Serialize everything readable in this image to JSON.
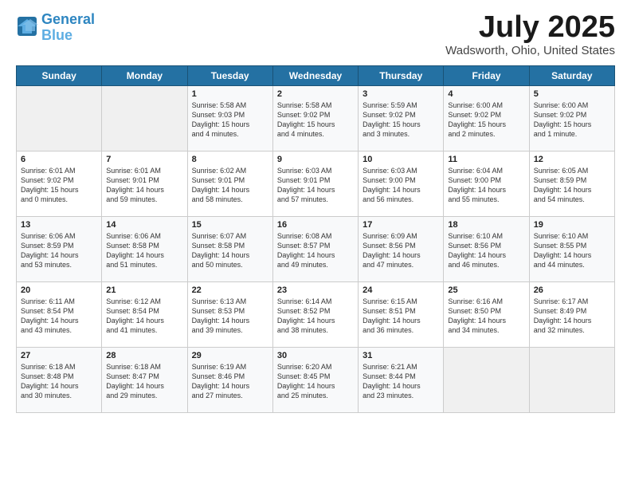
{
  "header": {
    "logo_line1": "General",
    "logo_line2": "Blue",
    "month": "July 2025",
    "location": "Wadsworth, Ohio, United States"
  },
  "weekdays": [
    "Sunday",
    "Monday",
    "Tuesday",
    "Wednesday",
    "Thursday",
    "Friday",
    "Saturday"
  ],
  "weeks": [
    [
      {
        "day": "",
        "info": ""
      },
      {
        "day": "",
        "info": ""
      },
      {
        "day": "1",
        "info": "Sunrise: 5:58 AM\nSunset: 9:03 PM\nDaylight: 15 hours\nand 4 minutes."
      },
      {
        "day": "2",
        "info": "Sunrise: 5:58 AM\nSunset: 9:02 PM\nDaylight: 15 hours\nand 4 minutes."
      },
      {
        "day": "3",
        "info": "Sunrise: 5:59 AM\nSunset: 9:02 PM\nDaylight: 15 hours\nand 3 minutes."
      },
      {
        "day": "4",
        "info": "Sunrise: 6:00 AM\nSunset: 9:02 PM\nDaylight: 15 hours\nand 2 minutes."
      },
      {
        "day": "5",
        "info": "Sunrise: 6:00 AM\nSunset: 9:02 PM\nDaylight: 15 hours\nand 1 minute."
      }
    ],
    [
      {
        "day": "6",
        "info": "Sunrise: 6:01 AM\nSunset: 9:02 PM\nDaylight: 15 hours\nand 0 minutes."
      },
      {
        "day": "7",
        "info": "Sunrise: 6:01 AM\nSunset: 9:01 PM\nDaylight: 14 hours\nand 59 minutes."
      },
      {
        "day": "8",
        "info": "Sunrise: 6:02 AM\nSunset: 9:01 PM\nDaylight: 14 hours\nand 58 minutes."
      },
      {
        "day": "9",
        "info": "Sunrise: 6:03 AM\nSunset: 9:01 PM\nDaylight: 14 hours\nand 57 minutes."
      },
      {
        "day": "10",
        "info": "Sunrise: 6:03 AM\nSunset: 9:00 PM\nDaylight: 14 hours\nand 56 minutes."
      },
      {
        "day": "11",
        "info": "Sunrise: 6:04 AM\nSunset: 9:00 PM\nDaylight: 14 hours\nand 55 minutes."
      },
      {
        "day": "12",
        "info": "Sunrise: 6:05 AM\nSunset: 8:59 PM\nDaylight: 14 hours\nand 54 minutes."
      }
    ],
    [
      {
        "day": "13",
        "info": "Sunrise: 6:06 AM\nSunset: 8:59 PM\nDaylight: 14 hours\nand 53 minutes."
      },
      {
        "day": "14",
        "info": "Sunrise: 6:06 AM\nSunset: 8:58 PM\nDaylight: 14 hours\nand 51 minutes."
      },
      {
        "day": "15",
        "info": "Sunrise: 6:07 AM\nSunset: 8:58 PM\nDaylight: 14 hours\nand 50 minutes."
      },
      {
        "day": "16",
        "info": "Sunrise: 6:08 AM\nSunset: 8:57 PM\nDaylight: 14 hours\nand 49 minutes."
      },
      {
        "day": "17",
        "info": "Sunrise: 6:09 AM\nSunset: 8:56 PM\nDaylight: 14 hours\nand 47 minutes."
      },
      {
        "day": "18",
        "info": "Sunrise: 6:10 AM\nSunset: 8:56 PM\nDaylight: 14 hours\nand 46 minutes."
      },
      {
        "day": "19",
        "info": "Sunrise: 6:10 AM\nSunset: 8:55 PM\nDaylight: 14 hours\nand 44 minutes."
      }
    ],
    [
      {
        "day": "20",
        "info": "Sunrise: 6:11 AM\nSunset: 8:54 PM\nDaylight: 14 hours\nand 43 minutes."
      },
      {
        "day": "21",
        "info": "Sunrise: 6:12 AM\nSunset: 8:54 PM\nDaylight: 14 hours\nand 41 minutes."
      },
      {
        "day": "22",
        "info": "Sunrise: 6:13 AM\nSunset: 8:53 PM\nDaylight: 14 hours\nand 39 minutes."
      },
      {
        "day": "23",
        "info": "Sunrise: 6:14 AM\nSunset: 8:52 PM\nDaylight: 14 hours\nand 38 minutes."
      },
      {
        "day": "24",
        "info": "Sunrise: 6:15 AM\nSunset: 8:51 PM\nDaylight: 14 hours\nand 36 minutes."
      },
      {
        "day": "25",
        "info": "Sunrise: 6:16 AM\nSunset: 8:50 PM\nDaylight: 14 hours\nand 34 minutes."
      },
      {
        "day": "26",
        "info": "Sunrise: 6:17 AM\nSunset: 8:49 PM\nDaylight: 14 hours\nand 32 minutes."
      }
    ],
    [
      {
        "day": "27",
        "info": "Sunrise: 6:18 AM\nSunset: 8:48 PM\nDaylight: 14 hours\nand 30 minutes."
      },
      {
        "day": "28",
        "info": "Sunrise: 6:18 AM\nSunset: 8:47 PM\nDaylight: 14 hours\nand 29 minutes."
      },
      {
        "day": "29",
        "info": "Sunrise: 6:19 AM\nSunset: 8:46 PM\nDaylight: 14 hours\nand 27 minutes."
      },
      {
        "day": "30",
        "info": "Sunrise: 6:20 AM\nSunset: 8:45 PM\nDaylight: 14 hours\nand 25 minutes."
      },
      {
        "day": "31",
        "info": "Sunrise: 6:21 AM\nSunset: 8:44 PM\nDaylight: 14 hours\nand 23 minutes."
      },
      {
        "day": "",
        "info": ""
      },
      {
        "day": "",
        "info": ""
      }
    ]
  ]
}
